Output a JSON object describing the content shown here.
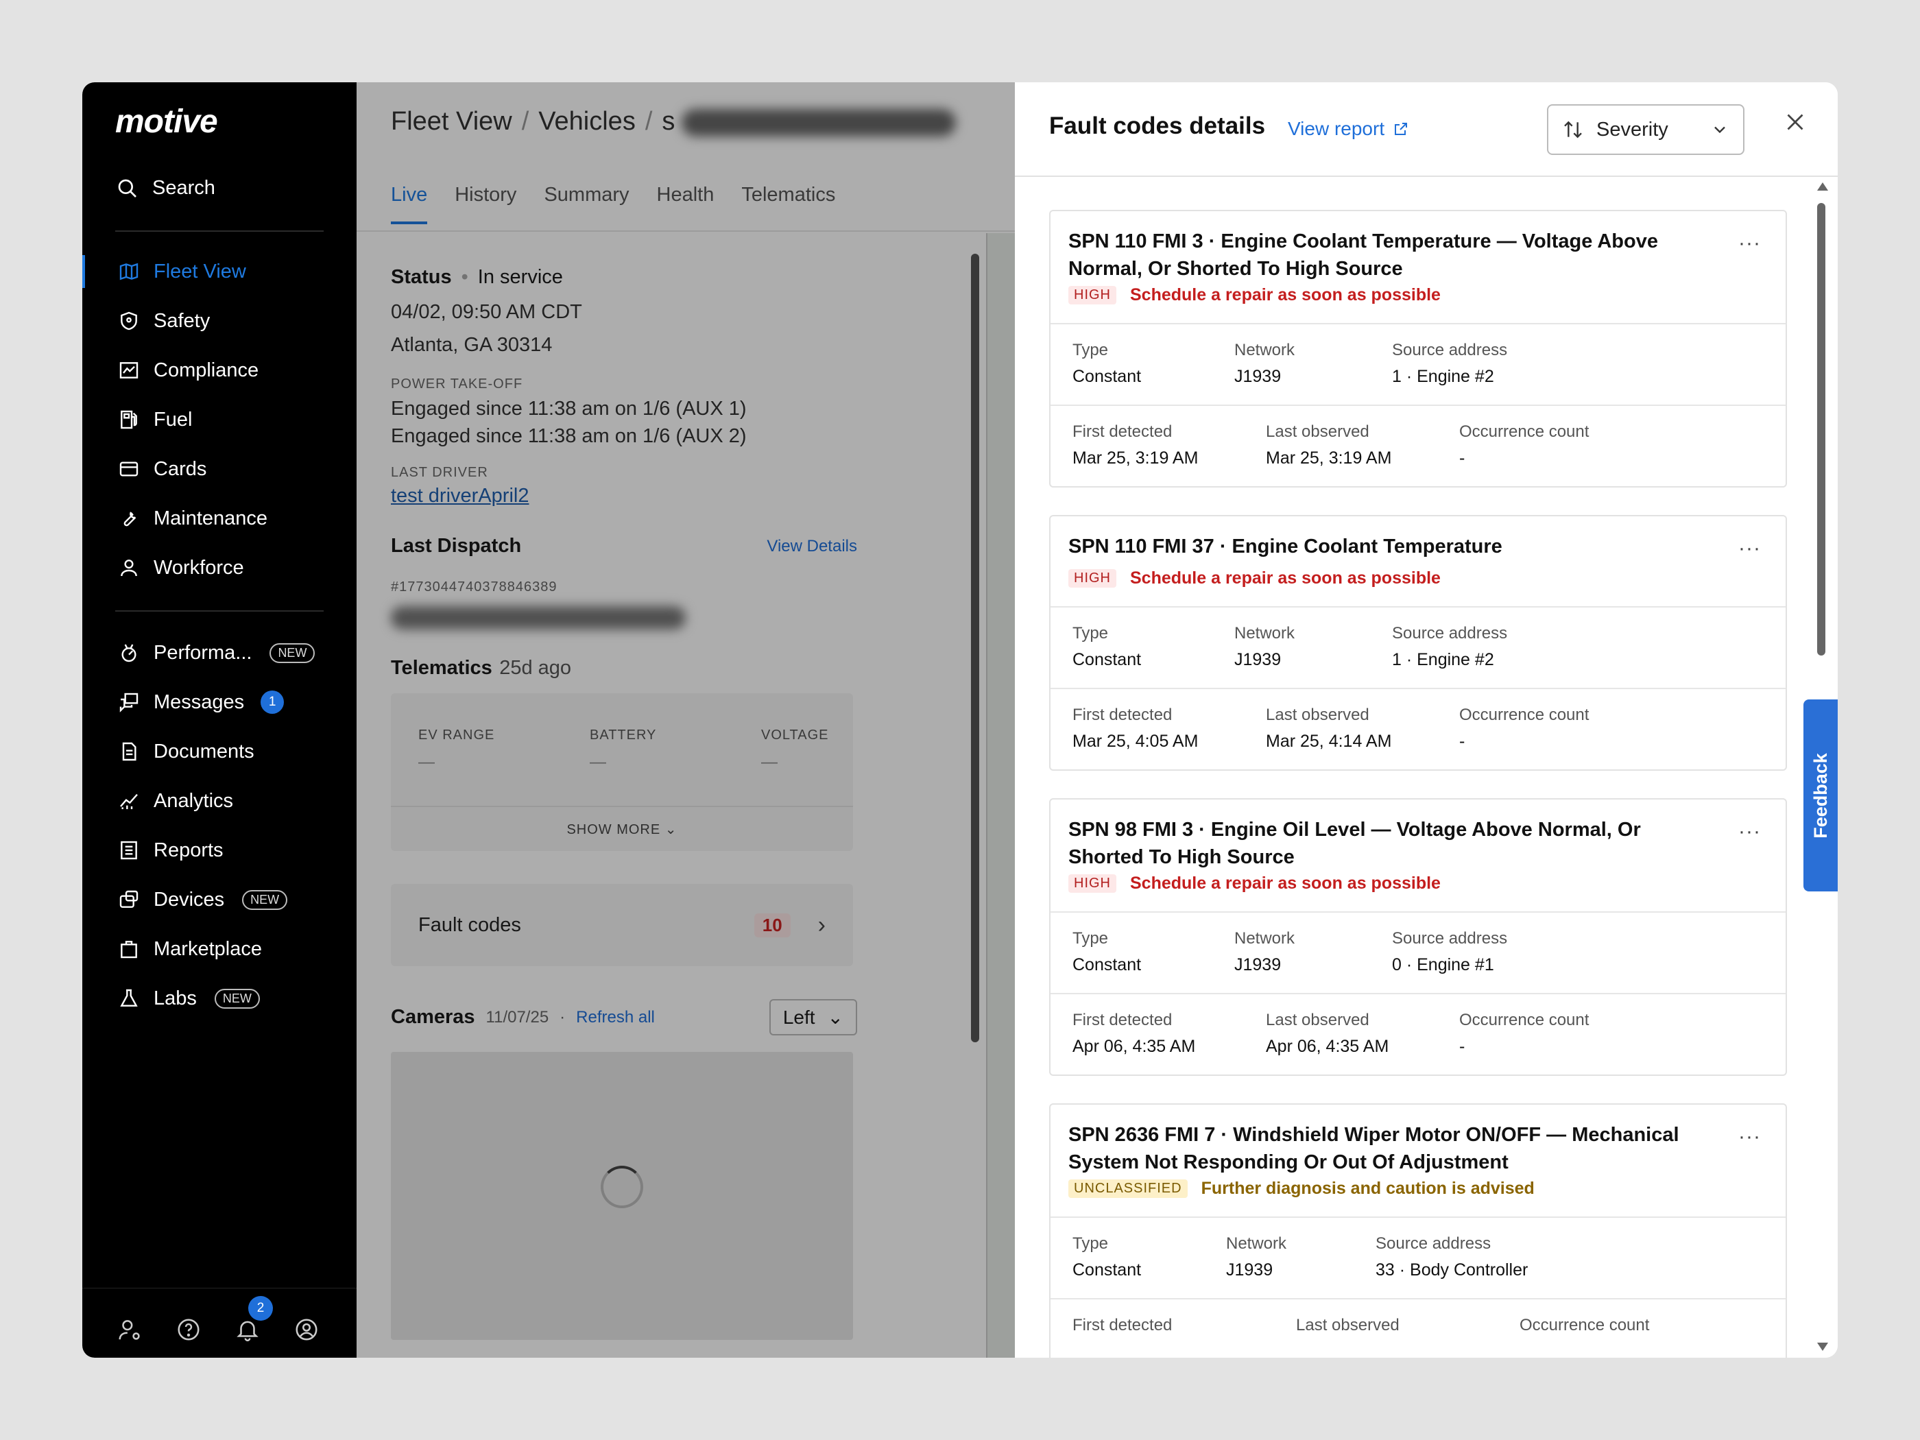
{
  "app": {
    "logo": "motive"
  },
  "sidebar": {
    "search_label": "Search",
    "items": [
      {
        "label": "Fleet View",
        "icon": "map-icon",
        "active": true
      },
      {
        "label": "Safety",
        "icon": "shield-icon"
      },
      {
        "label": "Compliance",
        "icon": "chart-icon"
      },
      {
        "label": "Fuel",
        "icon": "fuel-icon"
      },
      {
        "label": "Cards",
        "icon": "card-icon"
      },
      {
        "label": "Maintenance",
        "icon": "wrench-icon"
      },
      {
        "label": "Workforce",
        "icon": "person-icon"
      }
    ],
    "items2": [
      {
        "label": "Performa...",
        "icon": "gauge-icon",
        "badge": "NEW"
      },
      {
        "label": "Messages",
        "icon": "messages-icon",
        "count": "1"
      },
      {
        "label": "Documents",
        "icon": "document-icon"
      },
      {
        "label": "Analytics",
        "icon": "analytics-icon"
      },
      {
        "label": "Reports",
        "icon": "reports-icon"
      },
      {
        "label": "Devices",
        "icon": "devices-icon",
        "badge": "NEW"
      },
      {
        "label": "Marketplace",
        "icon": "bag-icon"
      },
      {
        "label": "Labs",
        "icon": "flask-icon",
        "badge": "NEW"
      }
    ],
    "notifications_count": "2"
  },
  "main": {
    "breadcrumb": [
      "Fleet View",
      "Vehicles"
    ],
    "breadcrumb_tail": "s",
    "tabs": [
      "Live",
      "History",
      "Summary",
      "Health",
      "Telematics"
    ],
    "status_label": "Status",
    "status_value": "In service",
    "datetime": "04/02, 09:50 AM CDT",
    "location": "Atlanta, GA 30314",
    "pto_label": "POWER TAKE-OFF",
    "pto_1": "Engaged since 11:38 am on 1/6 (AUX 1)",
    "pto_2": "Engaged since 11:38 am on 1/6 (AUX 2)",
    "last_driver_label": "LAST DRIVER",
    "last_driver": "test driverApril2",
    "last_dispatch_title": "Last Dispatch",
    "view_details": "View Details",
    "dispatch_id": "#1773044740378846389",
    "telematics_title": "Telematics",
    "telematics_age": "25d ago",
    "telematics": [
      {
        "label": "EV RANGE",
        "value": "—"
      },
      {
        "label": "BATTERY",
        "value": "—"
      },
      {
        "label": "VOLTAGE",
        "value": "—"
      }
    ],
    "show_more": "SHOW MORE",
    "fault_codes_label": "Fault codes",
    "fault_codes_count": "10",
    "cameras_title": "Cameras",
    "cameras_date": "11/07/25",
    "refresh_all": "Refresh all",
    "camera_select": "Left"
  },
  "panel": {
    "title": "Fault codes details",
    "view_report": "View report",
    "sort_label": "Severity",
    "feedback": "Feedback",
    "labels": {
      "type": "Type",
      "network": "Network",
      "source": "Source address",
      "first": "First detected",
      "last": "Last observed",
      "occ": "Occurrence count"
    },
    "faults": [
      {
        "title": "SPN 110 FMI 3 · Engine Coolant Temperature — Voltage Above Normal, Or Shorted To High Source",
        "severity": "HIGH",
        "message": "Schedule a repair as soon as possible",
        "type": "Constant",
        "network": "J1939",
        "source": "1 · Engine #2",
        "first": "Mar 25, 3:19 AM",
        "last": "Mar 25, 3:19 AM",
        "occ": "-"
      },
      {
        "title": "SPN 110 FMI 37 · Engine Coolant Temperature",
        "severity": "HIGH",
        "message": "Schedule a repair as soon as possible",
        "type": "Constant",
        "network": "J1939",
        "source": "1 · Engine #2",
        "first": "Mar 25, 4:05 AM",
        "last": "Mar 25, 4:14 AM",
        "occ": "-"
      },
      {
        "title": "SPN 98 FMI 3 · Engine Oil Level — Voltage Above Normal, Or Shorted To High Source",
        "severity": "HIGH",
        "message": "Schedule a repair as soon as possible",
        "type": "Constant",
        "network": "J1939",
        "source": "0 · Engine #1",
        "first": "Apr 06, 4:35 AM",
        "last": "Apr 06, 4:35 AM",
        "occ": "-"
      },
      {
        "title": "SPN 2636 FMI 7 · Windshield Wiper Motor ON/OFF — Mechanical System Not Responding Or Out Of Adjustment",
        "severity": "UNCLASSIFIED",
        "message": "Further diagnosis and caution is advised",
        "type": "Constant",
        "network": "J1939",
        "source": "33 · Body Controller",
        "first": "",
        "last": "",
        "occ": ""
      }
    ]
  }
}
